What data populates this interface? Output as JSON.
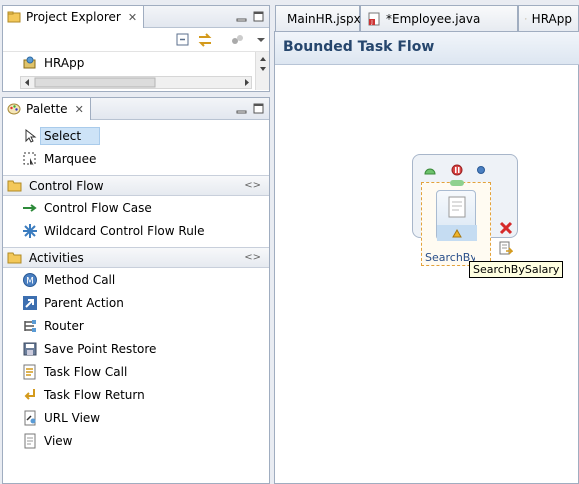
{
  "project_explorer": {
    "title": "Project Explorer",
    "tree_item": "HRApp"
  },
  "palette": {
    "title": "Palette",
    "tools": [
      {
        "label": "Select",
        "icon": "arrow-pointer-icon"
      },
      {
        "label": "Marquee",
        "icon": "marquee-icon"
      }
    ],
    "sections": [
      {
        "label": "Control Flow",
        "items": [
          {
            "label": "Control Flow Case",
            "icon": "green-arrow-icon"
          },
          {
            "label": "Wildcard Control Flow Rule",
            "icon": "asterisk-icon"
          }
        ]
      },
      {
        "label": "Activities",
        "items": [
          {
            "label": "Method Call",
            "icon": "method-call-icon"
          },
          {
            "label": "Parent Action",
            "icon": "parent-action-icon"
          },
          {
            "label": "Router",
            "icon": "router-icon"
          },
          {
            "label": "Save Point Restore",
            "icon": "save-point-icon"
          },
          {
            "label": "Task Flow Call",
            "icon": "task-flow-call-icon"
          },
          {
            "label": "Task Flow Return",
            "icon": "task-flow-return-icon"
          },
          {
            "label": "URL View",
            "icon": "url-view-icon"
          },
          {
            "label": "View",
            "icon": "view-icon"
          }
        ]
      }
    ]
  },
  "editor": {
    "tabs": [
      {
        "label": "MainHR.jspx"
      },
      {
        "label": "*Employee.java"
      },
      {
        "label": "HRApp"
      }
    ],
    "title": "Bounded Task Flow",
    "activity_label": "SearchByS",
    "tooltip": "SearchBySalary"
  },
  "colors": {
    "title_text": "#26466d",
    "selection_bg": "#cde3f7",
    "tooltip_bg": "#ffffe1",
    "activity_border": "#e2a23c"
  }
}
